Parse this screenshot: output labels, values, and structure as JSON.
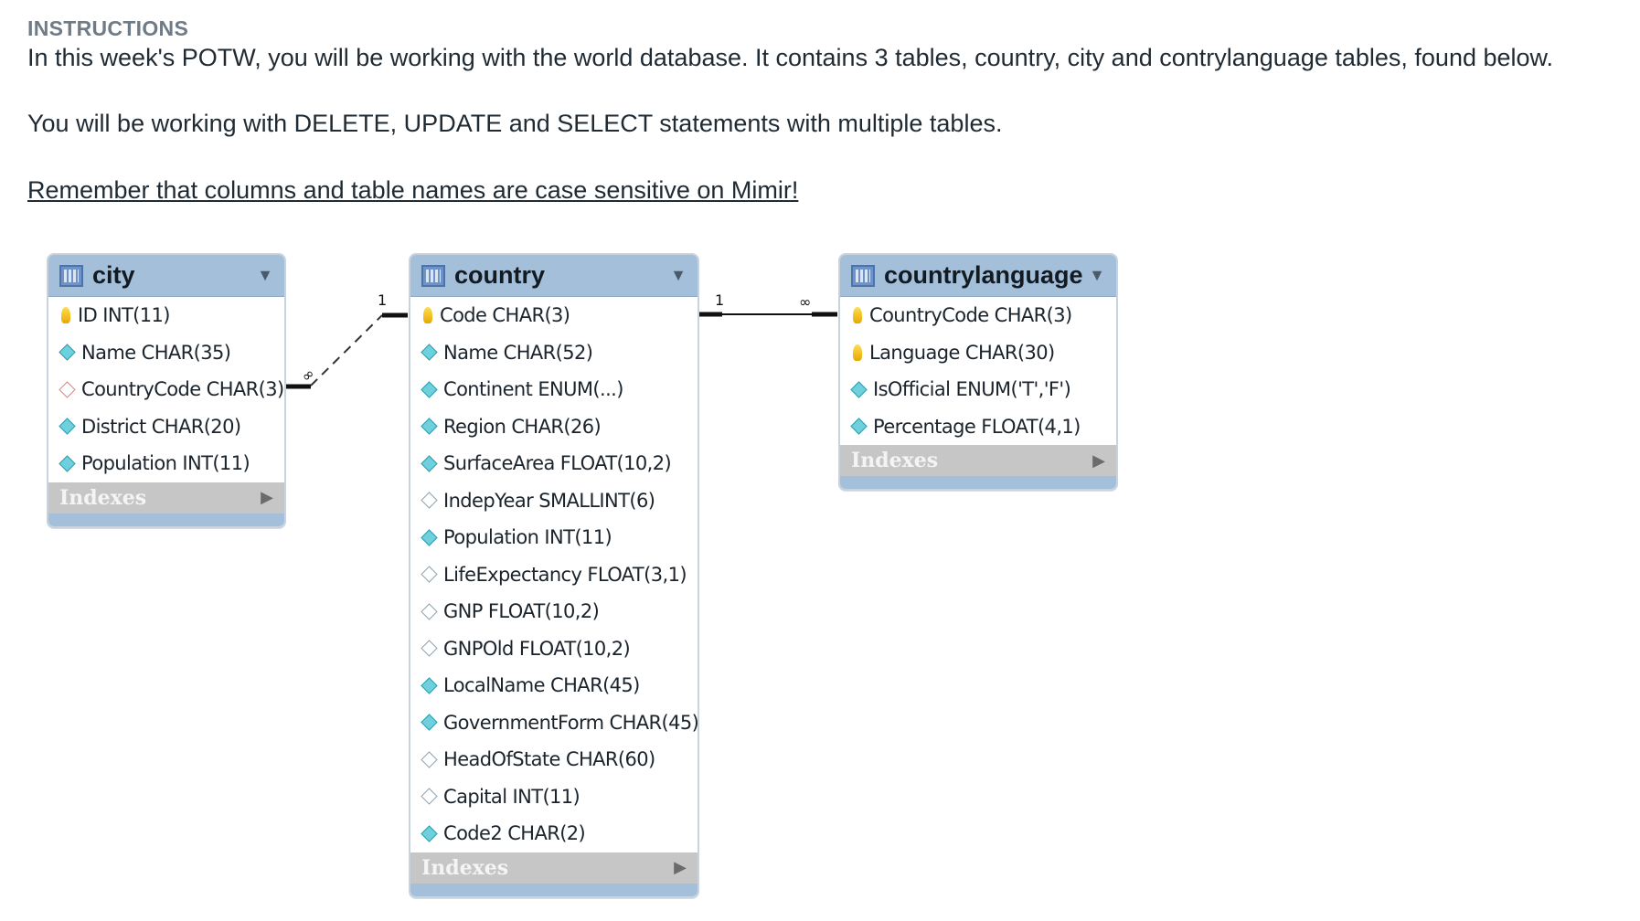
{
  "instructions": {
    "heading": "INSTRUCTIONS",
    "paragraph1": "In this week's POTW, you will be working with the world database. It contains 3 tables, country, city and contrylanguage tables, found below.",
    "paragraph2": "You will be working with DELETE, UPDATE and SELECT statements with multiple tables.",
    "paragraph3": "Remember that columns and table names are case sensitive on Mimir!"
  },
  "diagram": {
    "tables": [
      {
        "name": "city",
        "toggle_icon": "triangle-down",
        "columns": [
          {
            "label": "ID INT(11)",
            "icon": "primary-key-icon"
          },
          {
            "label": "Name CHAR(35)",
            "icon": "column-icon"
          },
          {
            "label": "CountryCode CHAR(3)",
            "icon": "foreign-key-icon"
          },
          {
            "label": "District CHAR(20)",
            "icon": "column-icon"
          },
          {
            "label": "Population INT(11)",
            "icon": "column-icon"
          }
        ],
        "indexes_label": "Indexes"
      },
      {
        "name": "country",
        "toggle_icon": "triangle-down",
        "columns": [
          {
            "label": "Code CHAR(3)",
            "icon": "primary-key-icon"
          },
          {
            "label": "Name CHAR(52)",
            "icon": "column-icon"
          },
          {
            "label": "Continent ENUM(...)",
            "icon": "column-icon"
          },
          {
            "label": "Region CHAR(26)",
            "icon": "column-icon"
          },
          {
            "label": "SurfaceArea FLOAT(10,2)",
            "icon": "column-icon"
          },
          {
            "label": "IndepYear SMALLINT(6)",
            "icon": "nullable-column-icon"
          },
          {
            "label": "Population INT(11)",
            "icon": "column-icon"
          },
          {
            "label": "LifeExpectancy FLOAT(3,1)",
            "icon": "nullable-column-icon"
          },
          {
            "label": "GNP FLOAT(10,2)",
            "icon": "nullable-column-icon"
          },
          {
            "label": "GNPOld FLOAT(10,2)",
            "icon": "nullable-column-icon"
          },
          {
            "label": "LocalName CHAR(45)",
            "icon": "column-icon"
          },
          {
            "label": "GovernmentForm CHAR(45)",
            "icon": "column-icon"
          },
          {
            "label": "HeadOfState CHAR(60)",
            "icon": "nullable-column-icon"
          },
          {
            "label": "Capital INT(11)",
            "icon": "nullable-column-icon"
          },
          {
            "label": "Code2 CHAR(2)",
            "icon": "column-icon"
          }
        ],
        "indexes_label": "Indexes"
      },
      {
        "name": "countrylanguage",
        "toggle_icon": "triangle-down",
        "columns": [
          {
            "label": "CountryCode CHAR(3)",
            "icon": "primary-key-icon"
          },
          {
            "label": "Language CHAR(30)",
            "icon": "primary-key-icon"
          },
          {
            "label": "IsOfficial ENUM('T','F')",
            "icon": "column-icon"
          },
          {
            "label": "Percentage FLOAT(4,1)",
            "icon": "column-icon"
          }
        ],
        "indexes_label": "Indexes"
      }
    ],
    "relationships": [
      {
        "from": "city",
        "to": "country",
        "from_cardinality": "∞",
        "to_cardinality": "1",
        "style": "dashed"
      },
      {
        "from": "country",
        "to": "countrylanguage",
        "from_cardinality": "1",
        "to_cardinality": "∞",
        "style": "solid"
      }
    ]
  }
}
